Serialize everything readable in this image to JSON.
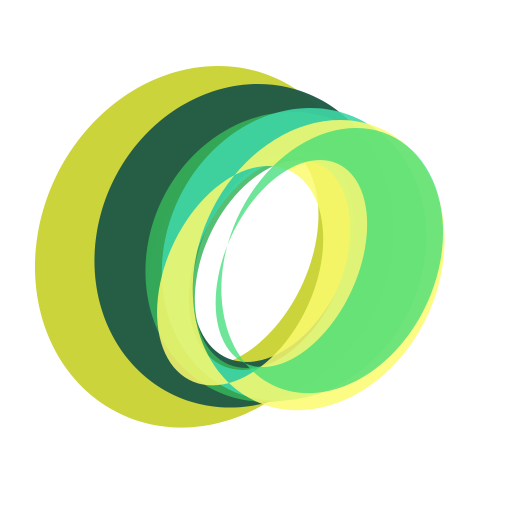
{
  "logo": {
    "name": "overlapping-rings-logo",
    "colors": {
      "background": "#ffffff",
      "olive_yellow_ring": "#cbd43a",
      "dark_green_ring": "#1f5a45",
      "mid_green_ring": "#37b45a",
      "teal_ring": "#3fd6a6",
      "bright_yellow_ring": "#fbfa6e",
      "light_green_ring": "#3fdc78"
    }
  }
}
